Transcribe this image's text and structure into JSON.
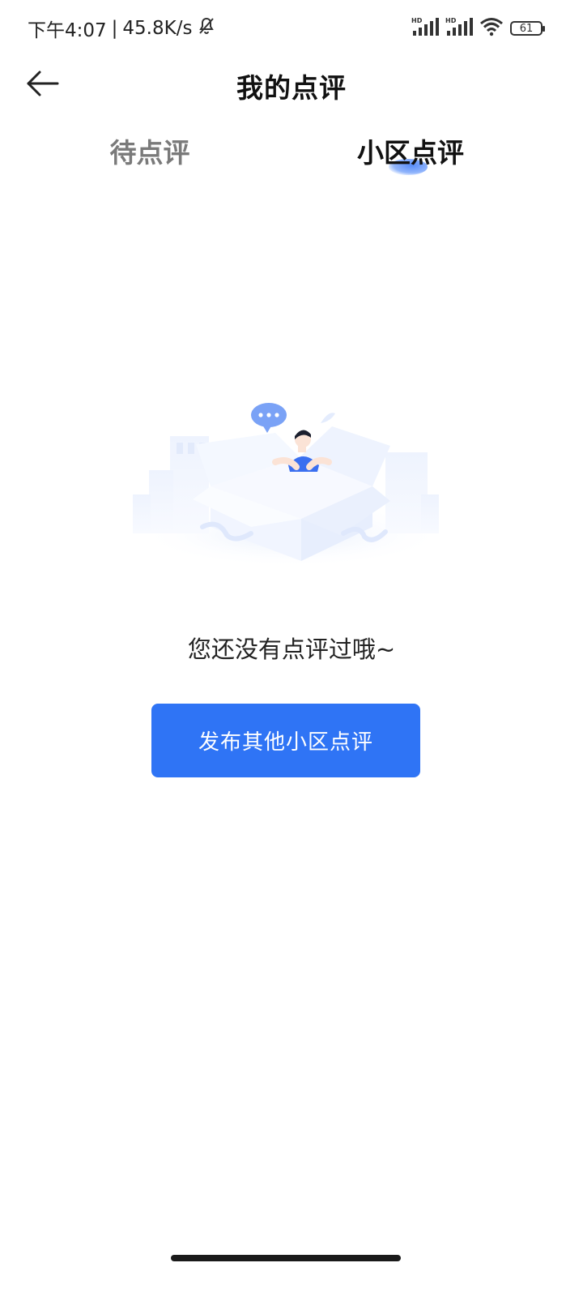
{
  "status_bar": {
    "time": "下午4:07",
    "separator": "|",
    "network_speed": "45.8K/s",
    "battery_level": "61",
    "signal_label_1": "HD",
    "signal_label_2": "HD",
    "icons": [
      "bell-off-icon",
      "signal-icon",
      "wifi-icon",
      "battery-icon"
    ]
  },
  "header": {
    "title": "我的点评",
    "back_icon": "arrow-left-icon"
  },
  "tabs": [
    {
      "label": "待点评",
      "active": false
    },
    {
      "label": "小区点评",
      "active": true
    }
  ],
  "empty_state": {
    "message": "您还没有点评过哦~",
    "button_label": "发布其他小区点评",
    "illustration": "empty-box-illustration"
  },
  "colors": {
    "accent": "#2f74f5",
    "tab_inactive": "#7a7a7a",
    "text_primary": "#111111"
  }
}
